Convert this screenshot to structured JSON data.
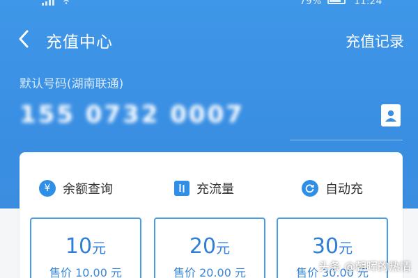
{
  "status_bar": {
    "battery_percent": "79%",
    "time": "11:24"
  },
  "nav": {
    "title": "充值中心",
    "record_link": "充值记录"
  },
  "account": {
    "default_label": "默认号码(湖南联通)",
    "phone_number": "155 0732 0007"
  },
  "functions": [
    {
      "label": "余额查询",
      "icon": "yen-search-icon"
    },
    {
      "label": "充流量",
      "icon": "data-flow-icon"
    },
    {
      "label": "自动充",
      "icon": "refresh-icon"
    }
  ],
  "amounts": [
    {
      "value": "10",
      "unit": "元",
      "price": "售价 10.00 元"
    },
    {
      "value": "20",
      "unit": "元",
      "price": "售价 20.00 元"
    },
    {
      "value": "30",
      "unit": "元",
      "price": "售价 30.00 元"
    }
  ],
  "watermark": "头条 @朝晖的热情",
  "colors": {
    "header_blue": "#3a8fe3",
    "accent_blue": "#2f8ee5",
    "amount_text": "#2f7fd6"
  }
}
